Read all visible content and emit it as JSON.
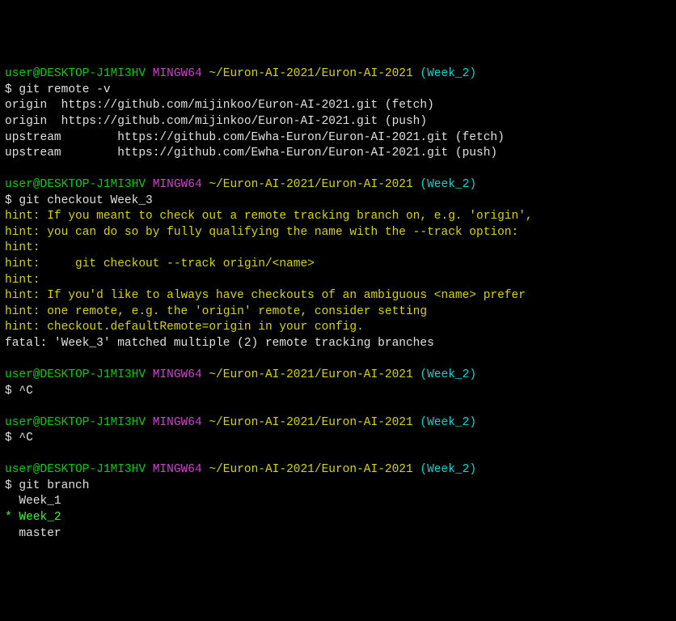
{
  "blocks": [
    {
      "prompt": {
        "user": "user@DESKTOP-J1MI3HV",
        "env": "MINGW64",
        "path": "~/Euron-AI-2021/Euron-AI-2021",
        "branch": "(Week_2)"
      },
      "command": "$ git remote -v",
      "output": [
        "origin  https://github.com/mijinkoo/Euron-AI-2021.git (fetch)",
        "origin  https://github.com/mijinkoo/Euron-AI-2021.git (push)",
        "upstream        https://github.com/Ewha-Euron/Euron-AI-2021.git (fetch)",
        "upstream        https://github.com/Ewha-Euron/Euron-AI-2021.git (push)"
      ]
    },
    {
      "prompt": {
        "user": "user@DESKTOP-J1MI3HV",
        "env": "MINGW64",
        "path": "~/Euron-AI-2021/Euron-AI-2021",
        "branch": "(Week_2)"
      },
      "command": "$ git checkout Week_3",
      "hints": [
        "hint: If you meant to check out a remote tracking branch on, e.g. 'origin',",
        "hint: you can do so by fully qualifying the name with the --track option:",
        "hint:",
        "hint:     git checkout --track origin/<name>",
        "hint:",
        "hint: If you'd like to always have checkouts of an ambiguous <name> prefer",
        "hint: one remote, e.g. the 'origin' remote, consider setting",
        "hint: checkout.defaultRemote=origin in your config."
      ],
      "fatal": "fatal: 'Week_3' matched multiple (2) remote tracking branches"
    },
    {
      "prompt": {
        "user": "user@DESKTOP-J1MI3HV",
        "env": "MINGW64",
        "path": "~/Euron-AI-2021/Euron-AI-2021",
        "branch": "(Week_2)"
      },
      "command": "$ ^C"
    },
    {
      "prompt": {
        "user": "user@DESKTOP-J1MI3HV",
        "env": "MINGW64",
        "path": "~/Euron-AI-2021/Euron-AI-2021",
        "branch": "(Week_2)"
      },
      "command": "$ ^C"
    },
    {
      "prompt": {
        "user": "user@DESKTOP-J1MI3HV",
        "env": "MINGW64",
        "path": "~/Euron-AI-2021/Euron-AI-2021",
        "branch": "(Week_2)"
      },
      "command": "$ git branch",
      "branches": [
        {
          "marker": " ",
          "name": "Week_1",
          "current": false
        },
        {
          "marker": "*",
          "name": "Week_2",
          "current": true
        },
        {
          "marker": " ",
          "name": "master",
          "current": false
        }
      ]
    }
  ]
}
